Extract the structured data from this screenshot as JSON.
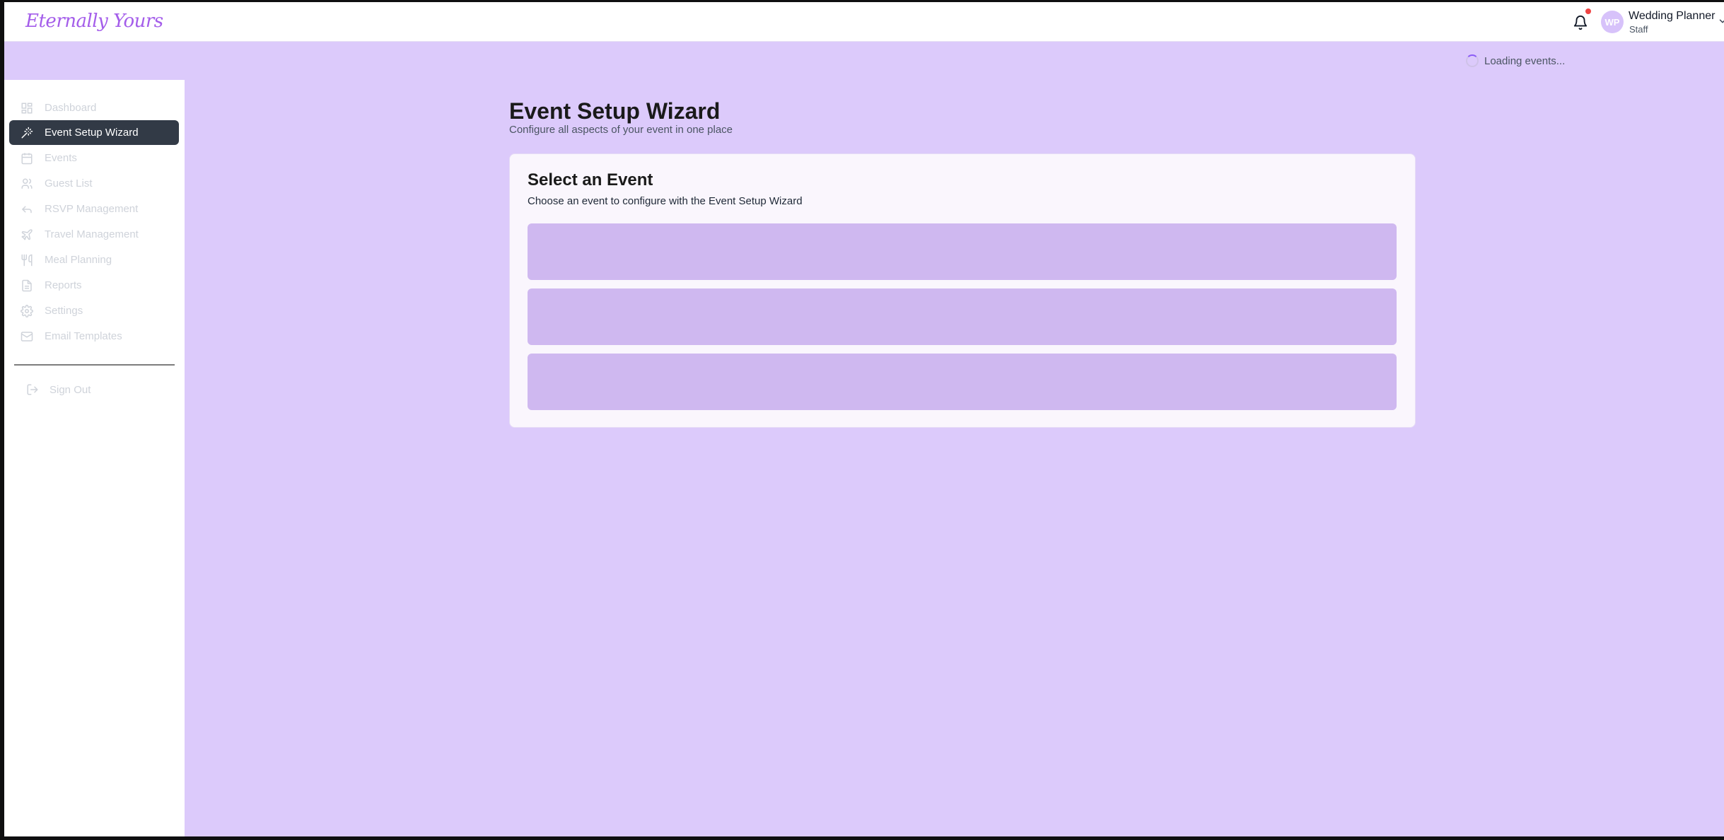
{
  "app": {
    "logo_text": "Eternally Yours"
  },
  "header": {
    "user_initials": "WP",
    "user_name": "Wedding Planner",
    "user_role": "Staff",
    "has_notification": true
  },
  "status": {
    "loading_text": "Loading events..."
  },
  "sidebar": {
    "items": [
      {
        "label": "Dashboard",
        "icon": "dashboard-icon",
        "active": false
      },
      {
        "label": "Event Setup Wizard",
        "icon": "wand-icon",
        "active": true
      },
      {
        "label": "Events",
        "icon": "calendar-icon",
        "active": false
      },
      {
        "label": "Guest List",
        "icon": "users-icon",
        "active": false
      },
      {
        "label": "RSVP Management",
        "icon": "reply-icon",
        "active": false
      },
      {
        "label": "Travel Management",
        "icon": "plane-icon",
        "active": false
      },
      {
        "label": "Meal Planning",
        "icon": "utensils-icon",
        "active": false
      },
      {
        "label": "Reports",
        "icon": "file-icon",
        "active": false
      },
      {
        "label": "Settings",
        "icon": "gear-icon",
        "active": false
      },
      {
        "label": "Email Templates",
        "icon": "mail-icon",
        "active": false
      }
    ],
    "sign_out_label": "Sign Out"
  },
  "main": {
    "title": "Event Setup Wizard",
    "subtitle": "Configure all aspects of your event in one place",
    "card": {
      "title": "Select an Event",
      "subtitle": "Choose an event to configure with the Event Setup Wizard",
      "skeleton_count": 3
    }
  },
  "colors": {
    "background": "#dccafb",
    "active_nav": "#323a46",
    "skeleton": "#cfb8f0",
    "brand": "#a45dea",
    "notification": "#ef4444"
  }
}
